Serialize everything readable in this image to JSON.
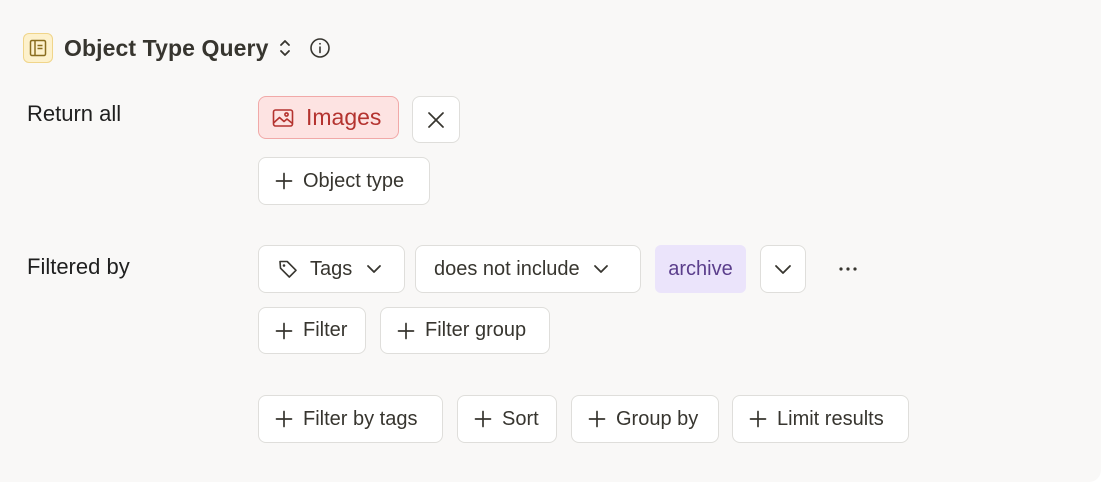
{
  "header": {
    "title": "Object Type Query",
    "icons": [
      "query-panel-icon",
      "chevron-up-down-icon",
      "info-icon"
    ]
  },
  "return_all": {
    "label": "Return all",
    "object_types": [
      {
        "label": "Images",
        "icon": "image-icon",
        "color": "#b4332f",
        "background": "#fde3e2"
      }
    ],
    "add_object_type_label": "Object type"
  },
  "filtered_by": {
    "label": "Filtered by",
    "filter": {
      "property_label": "Tags",
      "property_icon": "tag-icon",
      "operator_label": "does not include",
      "value_label": "archive"
    },
    "add_filter_label": "Filter",
    "add_filter_group_label": "Filter group"
  },
  "actions": {
    "filter_by_tags_label": "Filter by tags",
    "sort_label": "Sort",
    "group_by_label": "Group by",
    "limit_results_label": "Limit results"
  },
  "colors": {
    "panel_background": "#f9f8f7",
    "query_icon_background": "#fdf1cc",
    "archive_chip_background": "#ebe4fb"
  }
}
